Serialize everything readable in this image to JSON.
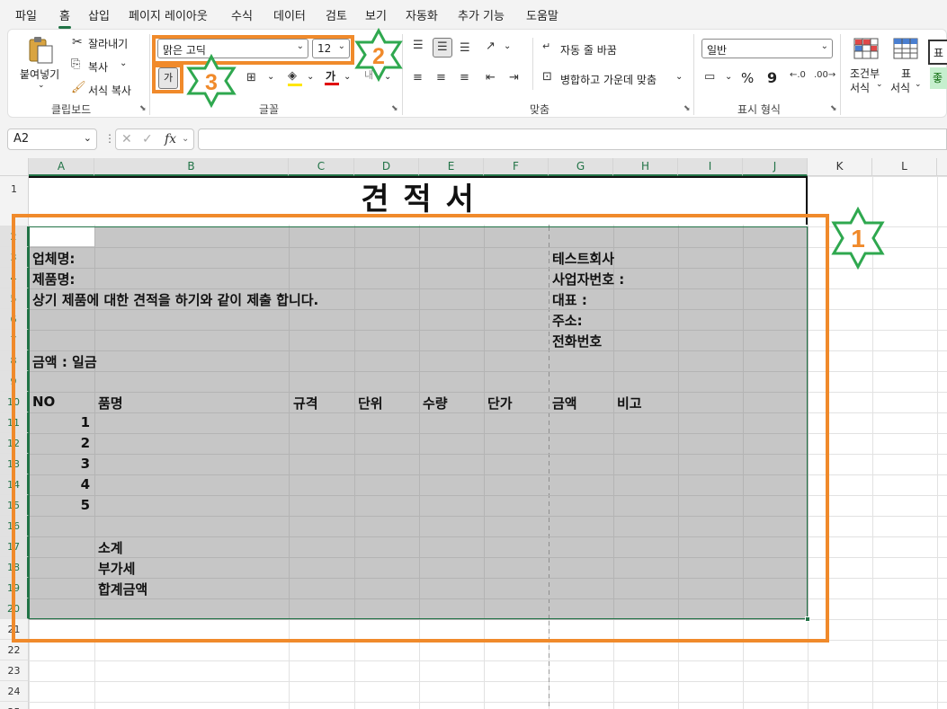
{
  "menu": {
    "items": [
      "파일",
      "홈",
      "삽입",
      "페이지 레이아웃",
      "수식",
      "데이터",
      "검토",
      "보기",
      "자동화",
      "추가 기능",
      "도움말"
    ],
    "active": "홈"
  },
  "ribbon": {
    "clipboard": {
      "paste": "붙여넣기",
      "cut": "잘라내기",
      "copy": "복사",
      "format_painter": "서식 복사",
      "label": "클립보드"
    },
    "font": {
      "name": "맑은 고딕",
      "size": "12",
      "bold_glyph": "가",
      "font_color_glyph": "가",
      "label": "글꼴"
    },
    "alignment": {
      "wrap": "자동 줄 바꿈",
      "merge": "병합하고 가운데 맞춤",
      "label": "맞춤"
    },
    "number": {
      "format": "일반",
      "percent": "%",
      "comma": "9",
      "label": "표시 형식"
    },
    "styles": {
      "conditional": "조건부",
      "conditional2": "서식",
      "table": "표",
      "table2": "서식",
      "cell_style_1": "표",
      "cell_style_2": "좋"
    }
  },
  "formula_bar": {
    "name_box": "A2",
    "fx": "fx",
    "value": ""
  },
  "sheet": {
    "columns": [
      "A",
      "B",
      "C",
      "D",
      "E",
      "F",
      "G",
      "H",
      "I",
      "J",
      "K",
      "L"
    ],
    "title": "견 적 서",
    "cells": {
      "company_label": "업체명:",
      "product_label": "제품명:",
      "statement": "상기 제품에 대한 견적을 하기와 같이 제출 합니다.",
      "amount_label": "금액 : 일금",
      "vendor_name": "테스트회사",
      "biz_no": "사업자번호 :",
      "ceo": "대표 :",
      "address": "주소:",
      "phone": "전화번호"
    },
    "table_headers": [
      "NO",
      "품명",
      "규격",
      "단위",
      "수량",
      "단가",
      "금액",
      "비고"
    ],
    "row_numbers": [
      "1",
      "2",
      "3",
      "4",
      "5"
    ],
    "summary": [
      "소계",
      "부가세",
      "합계금액"
    ]
  },
  "annotations": [
    "1",
    "2",
    "3"
  ],
  "colors": {
    "excel_green": "#217346",
    "annotation_orange": "#f08a2b",
    "annotation_star": "#2fa84f",
    "selection_fill": "#c6c6c6"
  }
}
